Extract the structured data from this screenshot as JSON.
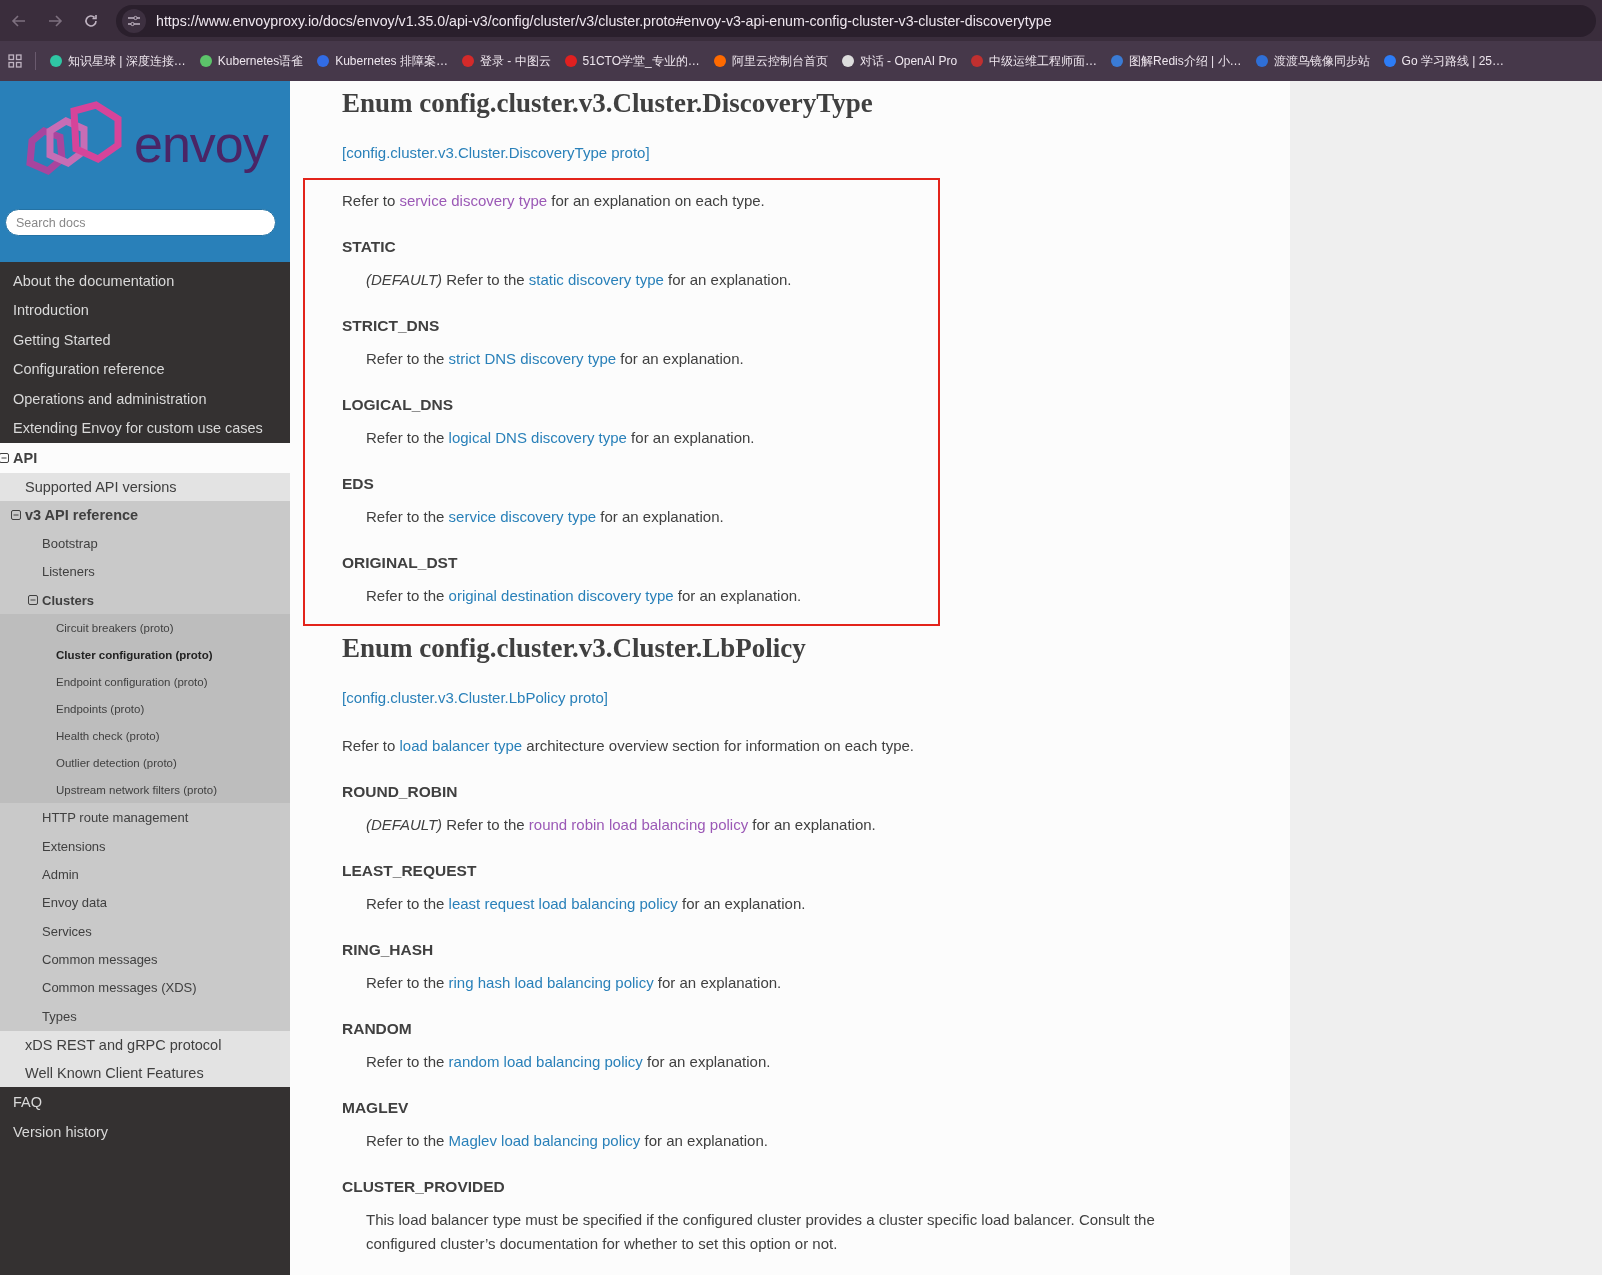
{
  "browser": {
    "url": "https://www.envoyproxy.io/docs/envoy/v1.35.0/api-v3/config/cluster/v3/cluster.proto#envoy-v3-api-enum-config-cluster-v3-cluster-discoverytype",
    "bookmarks": [
      {
        "label": "知识星球 | 深度连接…"
      },
      {
        "label": "Kubernetes语雀"
      },
      {
        "label": "Kubernetes 排障案…"
      },
      {
        "label": "登录 - 中图云"
      },
      {
        "label": "51CTO学堂_专业的…"
      },
      {
        "label": "阿里云控制台首页"
      },
      {
        "label": "对话 - OpenAI Pro"
      },
      {
        "label": "中级运维工程师面…"
      },
      {
        "label": "图解Redis介绍 | 小…"
      },
      {
        "label": "渡渡鸟镜像同步站"
      },
      {
        "label": "Go 学习路线 | 25…"
      }
    ]
  },
  "sidebar": {
    "logo_text": "envoy",
    "search": {
      "placeholder": "Search docs"
    },
    "items": [
      {
        "label": "About the documentation",
        "selected": false,
        "expanded": false
      },
      {
        "label": "Introduction",
        "selected": false,
        "expanded": false
      },
      {
        "label": "Getting Started",
        "selected": false,
        "expanded": false
      },
      {
        "label": "Configuration reference",
        "selected": false,
        "expanded": false
      },
      {
        "label": "Operations and administration",
        "selected": false,
        "expanded": false
      },
      {
        "label": "Extending Envoy for custom use cases",
        "selected": false,
        "expanded": false
      },
      {
        "label": "API",
        "selected": false,
        "expanded": true,
        "children": [
          {
            "label": "Supported API versions",
            "selected": false,
            "expanded": false
          },
          {
            "label": "v3 API reference",
            "selected": false,
            "expanded": true,
            "children": [
              {
                "label": "Bootstrap",
                "selected": false,
                "expanded": false
              },
              {
                "label": "Listeners",
                "selected": false,
                "expanded": false
              },
              {
                "label": "Clusters",
                "selected": false,
                "expanded": true,
                "children": [
                  {
                    "label": "Circuit breakers (proto)",
                    "selected": false,
                    "expanded": false
                  },
                  {
                    "label": "Cluster configuration (proto)",
                    "selected": true,
                    "expanded": false
                  },
                  {
                    "label": "Endpoint configuration (proto)",
                    "selected": false,
                    "expanded": false
                  },
                  {
                    "label": "Endpoints (proto)",
                    "selected": false,
                    "expanded": false
                  },
                  {
                    "label": "Health check (proto)",
                    "selected": false,
                    "expanded": false
                  },
                  {
                    "label": "Outlier detection (proto)",
                    "selected": false,
                    "expanded": false
                  },
                  {
                    "label": "Upstream network filters (proto)",
                    "selected": false,
                    "expanded": false
                  }
                ]
              },
              {
                "label": "HTTP route management",
                "selected": false,
                "expanded": false
              },
              {
                "label": "Extensions",
                "selected": false,
                "expanded": false
              },
              {
                "label": "Admin",
                "selected": false,
                "expanded": false
              },
              {
                "label": "Envoy data",
                "selected": false,
                "expanded": false
              },
              {
                "label": "Services",
                "selected": false,
                "expanded": false
              },
              {
                "label": "Common messages",
                "selected": false,
                "expanded": false
              },
              {
                "label": "Common messages (XDS)",
                "selected": false,
                "expanded": false
              },
              {
                "label": "Types",
                "selected": false,
                "expanded": false
              }
            ]
          },
          {
            "label": "xDS REST and gRPC protocol",
            "selected": false,
            "expanded": false
          },
          {
            "label": "Well Known Client Features",
            "selected": false,
            "expanded": false
          }
        ]
      },
      {
        "label": "FAQ",
        "selected": false,
        "expanded": false
      },
      {
        "label": "Version history",
        "selected": false,
        "expanded": false
      }
    ]
  },
  "content": {
    "enums": [
      {
        "title": "Enum config.cluster.v3.Cluster.DiscoveryType",
        "proto_link": "[config.cluster.v3.Cluster.DiscoveryType proto]",
        "highlighted": true,
        "intro": {
          "before": "Refer to ",
          "link": "service discovery type",
          "after": " for an explanation on each type.",
          "visited": true
        },
        "values": [
          {
            "name": "STATIC",
            "desc": {
              "before": "*(DEFAULT)* Refer to the ",
              "link": "static discovery type",
              "after": " for an explanation.",
              "visited": false
            }
          },
          {
            "name": "STRICT_DNS",
            "desc": {
              "before": "Refer to the ",
              "link": "strict DNS discovery type",
              "after": " for an explanation.",
              "visited": false
            }
          },
          {
            "name": "LOGICAL_DNS",
            "desc": {
              "before": "Refer to the ",
              "link": "logical DNS discovery type",
              "after": " for an explanation.",
              "visited": false
            }
          },
          {
            "name": "EDS",
            "desc": {
              "before": "Refer to the ",
              "link": "service discovery type",
              "after": " for an explanation.",
              "visited": false
            }
          },
          {
            "name": "ORIGINAL_DST",
            "desc": {
              "before": "Refer to the ",
              "link": "original destination discovery type",
              "after": " for an explanation.",
              "visited": false
            }
          }
        ]
      },
      {
        "title": "Enum config.cluster.v3.Cluster.LbPolicy",
        "proto_link": "[config.cluster.v3.Cluster.LbPolicy proto]",
        "intro": {
          "before": "Refer to ",
          "link": "load balancer type",
          "after": " architecture overview section for information on each type.",
          "visited": false
        },
        "values": [
          {
            "name": "ROUND_ROBIN",
            "desc": {
              "before": "*(DEFAULT)* Refer to the ",
              "link": "round robin load balancing policy",
              "after": " for an explanation.",
              "visited": true
            }
          },
          {
            "name": "LEAST_REQUEST",
            "desc": {
              "before": "Refer to the ",
              "link": "least request load balancing policy",
              "after": " for an explanation.",
              "visited": false
            }
          },
          {
            "name": "RING_HASH",
            "desc": {
              "before": "Refer to the ",
              "link": "ring hash load balancing policy",
              "after": " for an explanation.",
              "visited": false
            }
          },
          {
            "name": "RANDOM",
            "desc": {
              "before": "Refer to the ",
              "link": "random load balancing policy",
              "after": " for an explanation.",
              "visited": false
            }
          },
          {
            "name": "MAGLEV",
            "desc": {
              "before": "Refer to the ",
              "link": "Maglev load balancing policy",
              "after": " for an explanation.",
              "visited": false
            }
          },
          {
            "name": "CLUSTER_PROVIDED",
            "desc": {
              "before": "This load balancer type must be specified if the configured cluster provides a cluster specific load balancer. Consult the configured cluster’s documentation for whether to set this option or not."
            }
          }
        ]
      }
    ]
  }
}
